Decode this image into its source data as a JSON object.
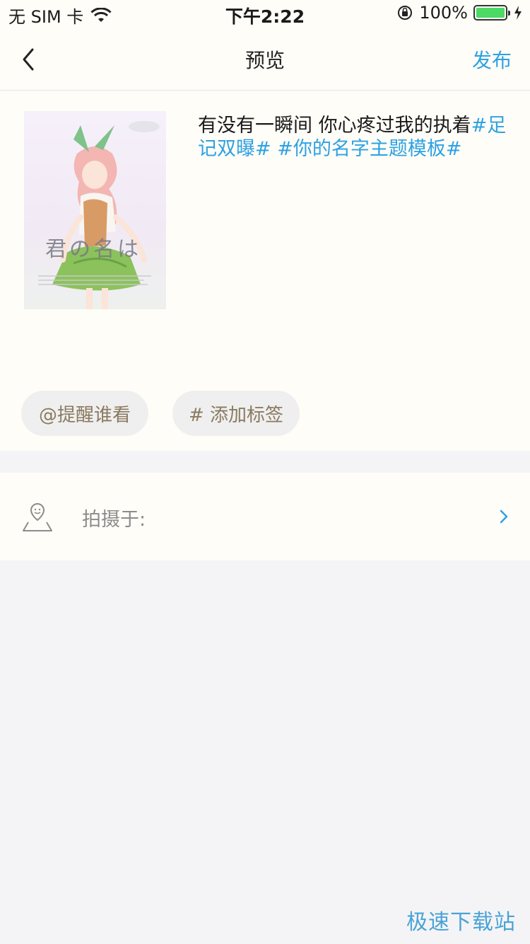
{
  "status_bar": {
    "carrier": "无 SIM 卡",
    "time": "下午2:22",
    "battery": "100%",
    "battery_level": 1.0
  },
  "nav": {
    "title": "预览",
    "action": "发布",
    "back_icon": "chevron-left-icon"
  },
  "post": {
    "caption_text": "有没有一瞬间 你心疼过我的执着",
    "caption_tags": "#足记双曝# #你的名字主题模板#",
    "image_text": "君の名は"
  },
  "chips": {
    "mention": "@提醒谁看",
    "tag": "# 添加标签"
  },
  "location": {
    "label": "拍摄于:",
    "icon": "map-pin-icon"
  },
  "watermark": "极速下载站",
  "colors": {
    "accent": "#2ea1e3",
    "chip_text": "#8a7a60",
    "background": "#f4f4f6",
    "panel": "#fefdf8"
  }
}
